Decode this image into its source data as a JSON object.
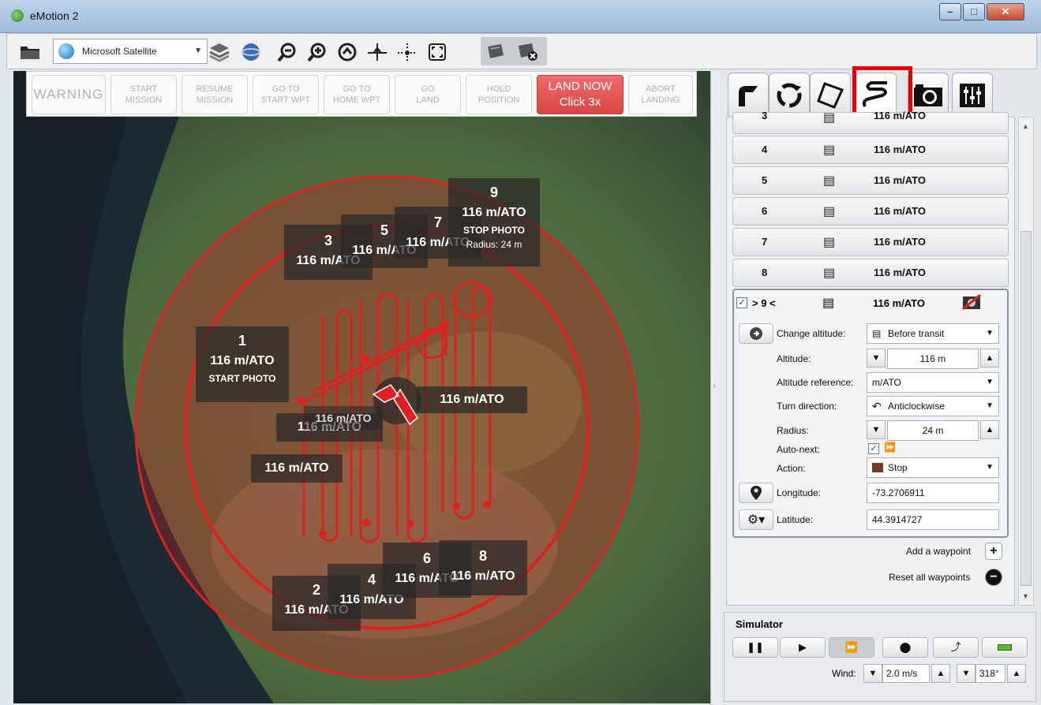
{
  "window": {
    "title": "eMotion 2",
    "minimize": "–",
    "maximize": "□",
    "close": "✕"
  },
  "toolbar": {
    "map_source": "Microsoft Satellite",
    "icons": [
      "folder-icon",
      "globe-icon",
      "layers-icon",
      "sphere-icon",
      "zoom-out-icon",
      "zoom-in-icon",
      "zoom-fit-icon",
      "center-drone-icon",
      "center-waypoint-icon",
      "fullscreen-icon",
      "view-toggle-icon",
      "view-hide-icon"
    ]
  },
  "commands": {
    "warning": "WARNING",
    "start_mission": [
      "START",
      "MISSION"
    ],
    "resume_mission": [
      "RESUME",
      "MISSION"
    ],
    "go_to_start": [
      "GO TO",
      "START WPT"
    ],
    "go_to_home": [
      "GO TO",
      "HOME WPT"
    ],
    "go_land": [
      "GO",
      "LAND"
    ],
    "hold_position": [
      "HOLD",
      "POSITION"
    ],
    "land_now": [
      "LAND NOW",
      "Click 3x"
    ],
    "abort_landing": [
      "ABORT",
      "LANDING"
    ]
  },
  "map_labels": [
    {
      "num": "1",
      "alt": "116 m/ATO",
      "act": "START PHOTO"
    },
    {
      "num": "2",
      "alt": "116 m/ATO"
    },
    {
      "num": "3",
      "alt": "116 m/ATO"
    },
    {
      "num": "4",
      "alt": "116 m/ATO"
    },
    {
      "num": "5",
      "alt": "116 m/ATO"
    },
    {
      "num": "6",
      "alt": "116 m/ATO"
    },
    {
      "num": "7",
      "alt": "116 m/ATO"
    },
    {
      "num": "8",
      "alt": "116 m/ATO"
    },
    {
      "num": "9",
      "alt": "116 m/ATO",
      "act": "STOP PHOTO",
      "radius": "Radius: 24 m"
    }
  ],
  "map_extra_labels": [
    "116 m/ATO",
    "116 m/ATO",
    "116 m/ATO",
    "116 m/ATO"
  ],
  "tabs": [
    "takeoff-icon",
    "loop-icon",
    "area-icon",
    "waypoint-path-icon",
    "camera-icon",
    "sliders-icon"
  ],
  "waypoints": [
    {
      "n": "3",
      "alt": "116 m/ATO"
    },
    {
      "n": "4",
      "alt": "116 m/ATO"
    },
    {
      "n": "5",
      "alt": "116 m/ATO"
    },
    {
      "n": "6",
      "alt": "116 m/ATO"
    },
    {
      "n": "7",
      "alt": "116 m/ATO"
    },
    {
      "n": "8",
      "alt": "116 m/ATO"
    }
  ],
  "selected": {
    "n": "> 9 <",
    "alt": "116 m/ATO",
    "change_altitude_label": "Change altitude:",
    "change_altitude_value": "Before transit",
    "altitude_label": "Altitude:",
    "altitude_value": "116 m",
    "altref_label": "Altitude reference:",
    "altref_value": "m/ATO",
    "turn_label": "Turn direction:",
    "turn_value": "Anticlockwise",
    "radius_label": "Radius:",
    "radius_value": "24 m",
    "autonext_label": "Auto-next:",
    "autonext_checked": true,
    "action_label": "Action:",
    "action_value": "Stop",
    "longitude_label": "Longitude:",
    "longitude_value": "-73.2706911",
    "latitude_label": "Latitude:",
    "latitude_value": "44.3914727"
  },
  "list_footer": {
    "add": "Add a waypoint",
    "reset": "Reset all waypoints"
  },
  "simulator": {
    "title": "Simulator",
    "wind_label": "Wind:",
    "wind_speed": "2.0 m/s",
    "wind_dir": "318°"
  }
}
